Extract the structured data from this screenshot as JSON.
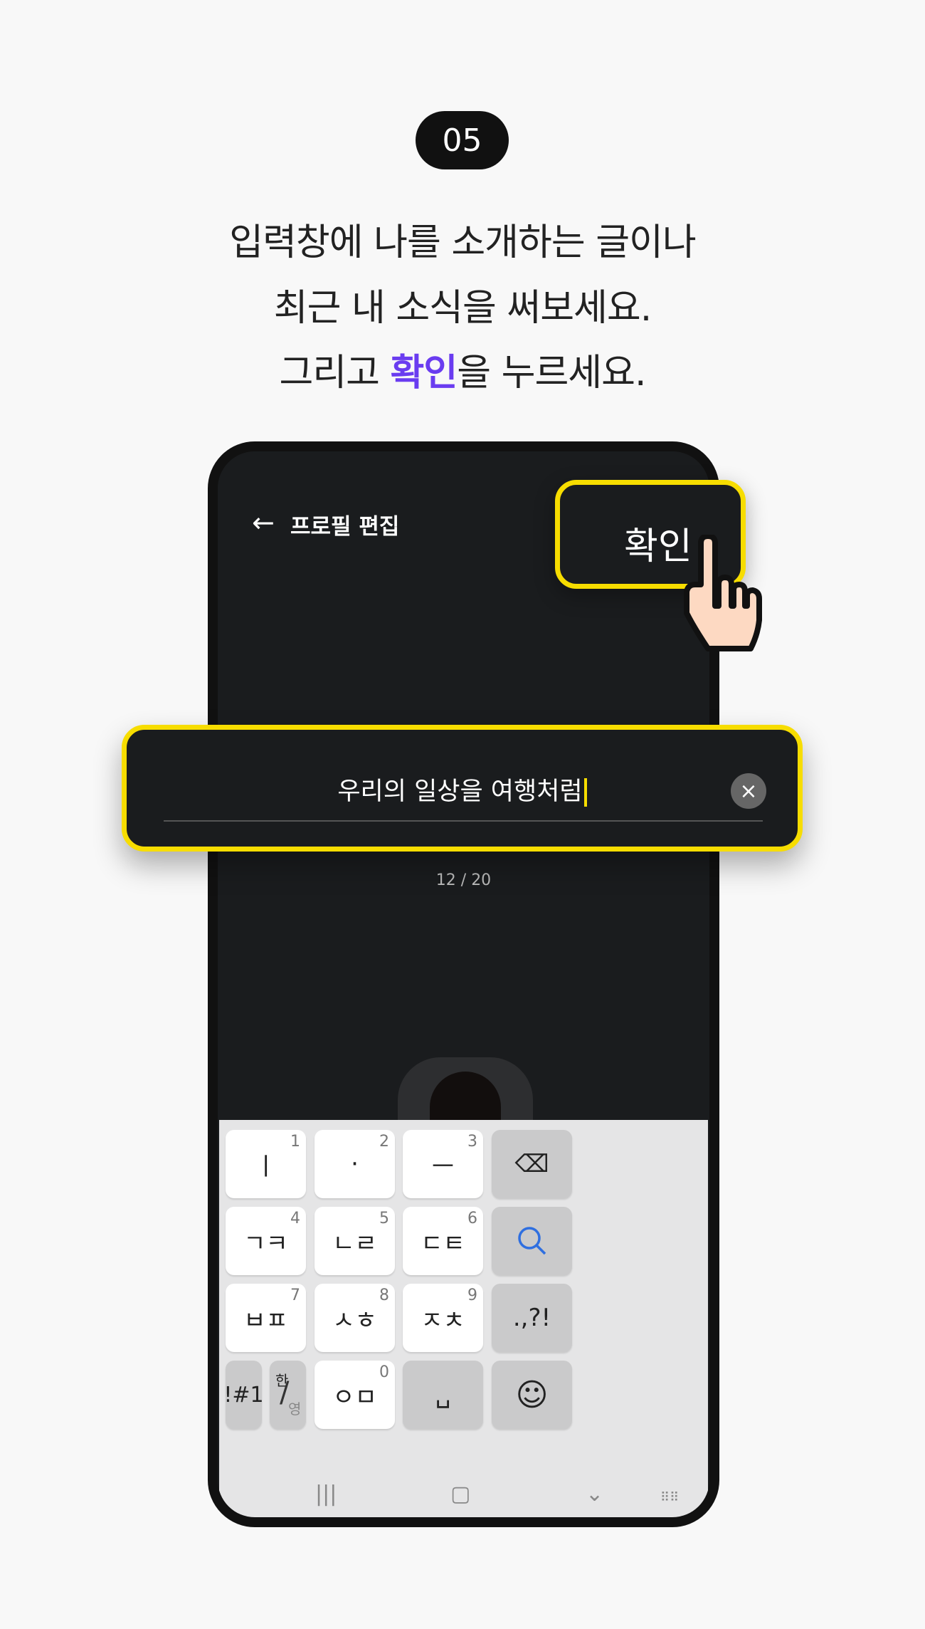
{
  "step": {
    "badge": "05"
  },
  "instructions": {
    "line1": "입력창에 나를 소개하는 글이나",
    "line2": "최근 내 소식을 써보세요.",
    "line3_pre": "그리고 ",
    "line3_accent": "확인",
    "line3_post": "을 누르세요.",
    "accent_color": "#6a3cf0",
    "highlight_color": "#f7dd00"
  },
  "header": {
    "back_icon": "arrow-left-icon",
    "title": "프로필 편집",
    "confirm_label": "확인"
  },
  "input": {
    "value": "우리의 일상을 여행처럼",
    "counter": "12 / 20",
    "clear_icon": "close-icon"
  },
  "keyboard": {
    "keys": [
      {
        "label": "ㅣ",
        "num": "1"
      },
      {
        "label": "·",
        "num": "2"
      },
      {
        "label": "ㅡ",
        "num": "3"
      },
      {
        "label": "⌫",
        "icon": "backspace-icon"
      },
      {
        "label": "ㄱㅋ",
        "num": "4"
      },
      {
        "label": "ㄴㄹ",
        "num": "5"
      },
      {
        "label": "ㄷㅌ",
        "num": "6"
      },
      {
        "label": "⚲",
        "icon": "search-icon"
      },
      {
        "label": "ㅂㅍ",
        "num": "7"
      },
      {
        "label": "ㅅㅎ",
        "num": "8"
      },
      {
        "label": "ㅈㅊ",
        "num": "9"
      },
      {
        "label": ".,?!"
      },
      {
        "label": "!#1"
      },
      {
        "label_top": "한",
        "label_bottom": "영"
      },
      {
        "label": "ㅇㅁ",
        "num": "0"
      },
      {
        "label": "␣",
        "icon": "space-icon"
      },
      {
        "label": "☺",
        "icon": "emoji-icon"
      }
    ]
  }
}
